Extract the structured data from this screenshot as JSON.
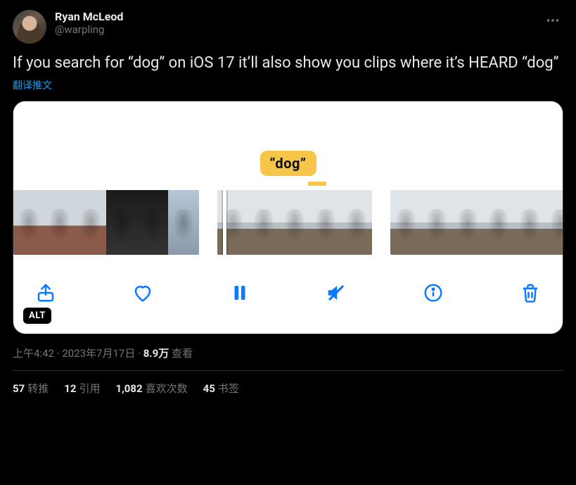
{
  "author": {
    "display_name": "Ryan McLeod",
    "handle": "@warpling"
  },
  "body": "If you search for “dog” on iOS 17 it’ll also show you clips where it’s HEARD “dog”",
  "translate_label": "翻译推文",
  "media": {
    "tag_text": "“dog”",
    "alt_badge": "ALT",
    "toolbar_icons": [
      "share-icon",
      "heart-icon",
      "pause-icon",
      "mute-icon",
      "info-icon",
      "trash-icon"
    ]
  },
  "meta": {
    "time": "上午4:42",
    "sep1": " · ",
    "date": "2023年7月17日",
    "sep2": " · ",
    "views_num": "8.9万",
    "views_label": " 查看"
  },
  "stats": {
    "retweets": {
      "num": "57",
      "label": "转推"
    },
    "quotes": {
      "num": "12",
      "label": "引用"
    },
    "likes": {
      "num": "1,082",
      "label": "喜欢次数"
    },
    "bookmarks": {
      "num": "45",
      "label": "书签"
    }
  }
}
